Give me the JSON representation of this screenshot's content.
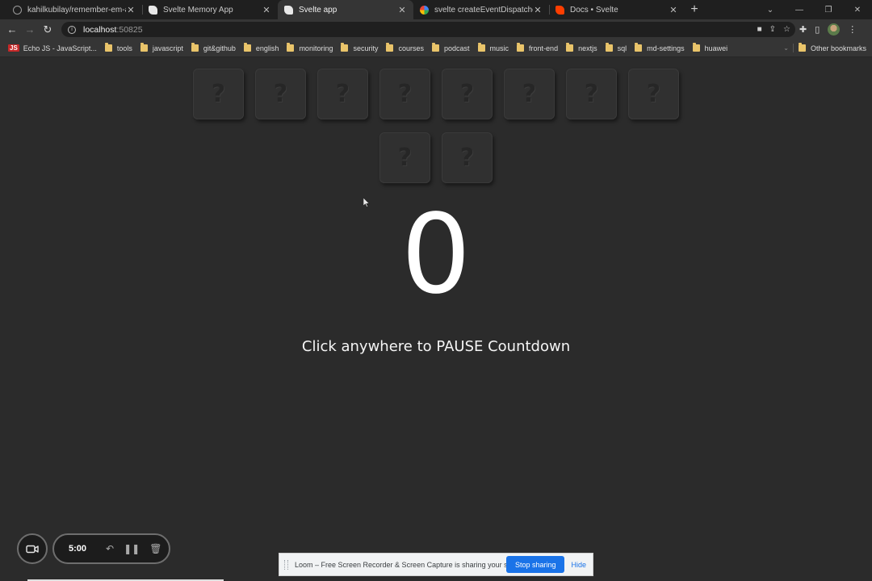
{
  "browser": {
    "tabs": [
      {
        "favicon": "github-icon",
        "title": "kahilkubilay/remember-em-all: M",
        "active": false
      },
      {
        "favicon": "svelte-icon",
        "title": "Svelte Memory App",
        "active": false
      },
      {
        "favicon": "svelte-icon",
        "title": "Svelte app",
        "active": true
      },
      {
        "favicon": "google-icon",
        "title": "svelte createEventDispatcher - G",
        "active": false
      },
      {
        "favicon": "svelte-red-icon",
        "title": "Docs • Svelte",
        "active": false
      }
    ],
    "new_tab_label": "+",
    "address": {
      "host": "localhost",
      "port": ":50825"
    },
    "bookmarks": [
      {
        "icon": "js-icon",
        "badge": "JS",
        "label": "Echo JS - JavaScript..."
      },
      {
        "icon": "folder-icon",
        "label": "tools"
      },
      {
        "icon": "folder-icon",
        "label": "javascript"
      },
      {
        "icon": "folder-icon",
        "label": "git&github"
      },
      {
        "icon": "folder-icon",
        "label": "english"
      },
      {
        "icon": "folder-icon",
        "label": "monitoring"
      },
      {
        "icon": "folder-icon",
        "label": "security"
      },
      {
        "icon": "folder-icon",
        "label": "courses"
      },
      {
        "icon": "folder-icon",
        "label": "podcast"
      },
      {
        "icon": "folder-icon",
        "label": "music"
      },
      {
        "icon": "folder-icon",
        "label": "front-end"
      },
      {
        "icon": "folder-icon",
        "label": "nextjs"
      },
      {
        "icon": "folder-icon",
        "label": "sql"
      },
      {
        "icon": "folder-icon",
        "label": "md-settings"
      },
      {
        "icon": "folder-icon",
        "label": "huawei"
      }
    ],
    "other_bookmarks": "Other bookmarks"
  },
  "game": {
    "cards": [
      "?",
      "?",
      "?",
      "?",
      "?",
      "?",
      "?",
      "?",
      "?",
      "?"
    ],
    "countdown": "0",
    "hint": "Click anywhere to PAUSE Countdown"
  },
  "loom": {
    "timer": "5:00",
    "share_message": "Loom – Free Screen Recorder & Screen Capture is sharing your screen.",
    "stop_label": "Stop sharing",
    "hide_label": "Hide"
  },
  "colors": {
    "page_bg": "#2b2b2b",
    "accent": "#1a73e8",
    "card_bg": "#303030"
  }
}
